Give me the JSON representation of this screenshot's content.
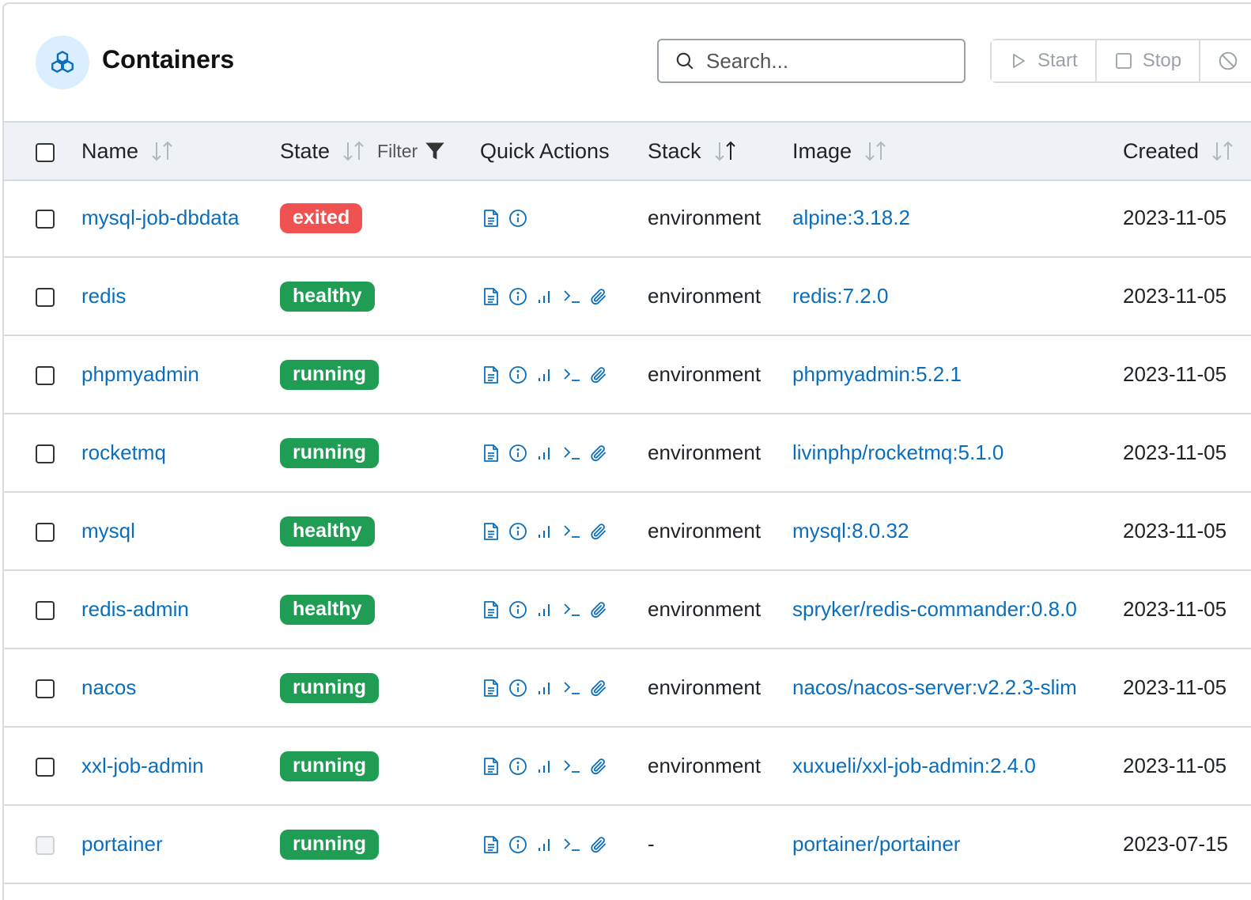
{
  "header": {
    "title": "Containers",
    "search_placeholder": "Search...",
    "buttons": {
      "start": "Start",
      "stop": "Stop"
    }
  },
  "columns": {
    "name": "Name",
    "state": "State",
    "filter": "Filter",
    "quick_actions": "Quick Actions",
    "stack": "Stack",
    "image": "Image",
    "created": "Created"
  },
  "colors": {
    "link": "#0a6ebd",
    "exited": "#f05252",
    "healthy": "#1f9d55",
    "running": "#1f9d55"
  },
  "icons": {
    "quick_actions": [
      "logs-icon",
      "inspect-icon",
      "stats-icon",
      "console-icon",
      "attach-icon"
    ]
  },
  "rows": [
    {
      "name": "mysql-job-dbdata",
      "state": "exited",
      "quick_actions": [
        "logs-icon",
        "inspect-icon"
      ],
      "stack": "environment",
      "image": "alpine:3.18.2",
      "created": "2023-11-05",
      "checkbox_disabled": false
    },
    {
      "name": "redis",
      "state": "healthy",
      "quick_actions": [
        "logs-icon",
        "inspect-icon",
        "stats-icon",
        "console-icon",
        "attach-icon"
      ],
      "stack": "environment",
      "image": "redis:7.2.0",
      "created": "2023-11-05",
      "checkbox_disabled": false
    },
    {
      "name": "phpmyadmin",
      "state": "running",
      "quick_actions": [
        "logs-icon",
        "inspect-icon",
        "stats-icon",
        "console-icon",
        "attach-icon"
      ],
      "stack": "environment",
      "image": "phpmyadmin:5.2.1",
      "created": "2023-11-05",
      "checkbox_disabled": false
    },
    {
      "name": "rocketmq",
      "state": "running",
      "quick_actions": [
        "logs-icon",
        "inspect-icon",
        "stats-icon",
        "console-icon",
        "attach-icon"
      ],
      "stack": "environment",
      "image": "livinphp/rocketmq:5.1.0",
      "created": "2023-11-05",
      "checkbox_disabled": false
    },
    {
      "name": "mysql",
      "state": "healthy",
      "quick_actions": [
        "logs-icon",
        "inspect-icon",
        "stats-icon",
        "console-icon",
        "attach-icon"
      ],
      "stack": "environment",
      "image": "mysql:8.0.32",
      "created": "2023-11-05",
      "checkbox_disabled": false
    },
    {
      "name": "redis-admin",
      "state": "healthy",
      "quick_actions": [
        "logs-icon",
        "inspect-icon",
        "stats-icon",
        "console-icon",
        "attach-icon"
      ],
      "stack": "environment",
      "image": "spryker/redis-commander:0.8.0",
      "created": "2023-11-05",
      "checkbox_disabled": false
    },
    {
      "name": "nacos",
      "state": "running",
      "quick_actions": [
        "logs-icon",
        "inspect-icon",
        "stats-icon",
        "console-icon",
        "attach-icon"
      ],
      "stack": "environment",
      "image": "nacos/nacos-server:v2.2.3-slim",
      "created": "2023-11-05",
      "checkbox_disabled": false
    },
    {
      "name": "xxl-job-admin",
      "state": "running",
      "quick_actions": [
        "logs-icon",
        "inspect-icon",
        "stats-icon",
        "console-icon",
        "attach-icon"
      ],
      "stack": "environment",
      "image": "xuxueli/xxl-job-admin:2.4.0",
      "created": "2023-11-05",
      "checkbox_disabled": false
    },
    {
      "name": "portainer",
      "state": "running",
      "quick_actions": [
        "logs-icon",
        "inspect-icon",
        "stats-icon",
        "console-icon",
        "attach-icon"
      ],
      "stack": "-",
      "image": "portainer/portainer",
      "created": "2023-07-15",
      "checkbox_disabled": true
    }
  ]
}
